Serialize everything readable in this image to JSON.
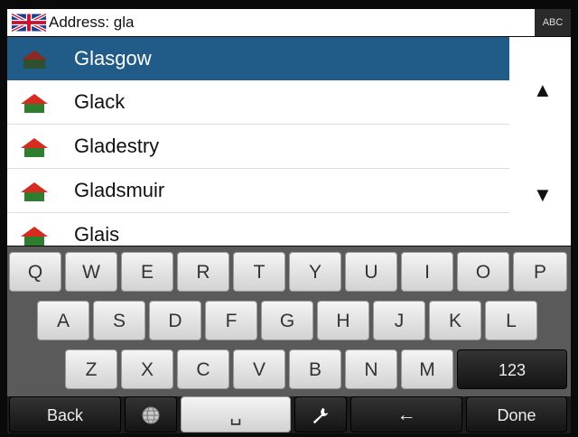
{
  "address_bar": {
    "text": "Address: gla",
    "mode_label": "ABC"
  },
  "results": [
    {
      "name": "Glasgow",
      "selected": true
    },
    {
      "name": "Glack"
    },
    {
      "name": "Gladestry"
    },
    {
      "name": "Gladsmuir"
    },
    {
      "name": "Glais"
    }
  ],
  "scroll": {
    "up": "▲",
    "down": "▼"
  },
  "keyboard": {
    "row1": [
      "Q",
      "W",
      "E",
      "R",
      "T",
      "Y",
      "U",
      "I",
      "O",
      "P"
    ],
    "row2": [
      "A",
      "S",
      "D",
      "F",
      "G",
      "H",
      "J",
      "K",
      "L"
    ],
    "row3": [
      "Z",
      "X",
      "C",
      "V",
      "B",
      "N",
      "M"
    ],
    "numbers_label": "123",
    "back_label": "Back",
    "done_label": "Done",
    "space_glyph": "␣",
    "backspace_glyph": "←",
    "icons": [
      "globe-icon",
      "wrench-icon",
      "backspace-icon"
    ]
  },
  "colors": {
    "selected_row": "#215b87",
    "keyboard_bg": "#5a5a5a",
    "house_roof": "#d62b1e",
    "house_base": "#2f7d2f"
  }
}
